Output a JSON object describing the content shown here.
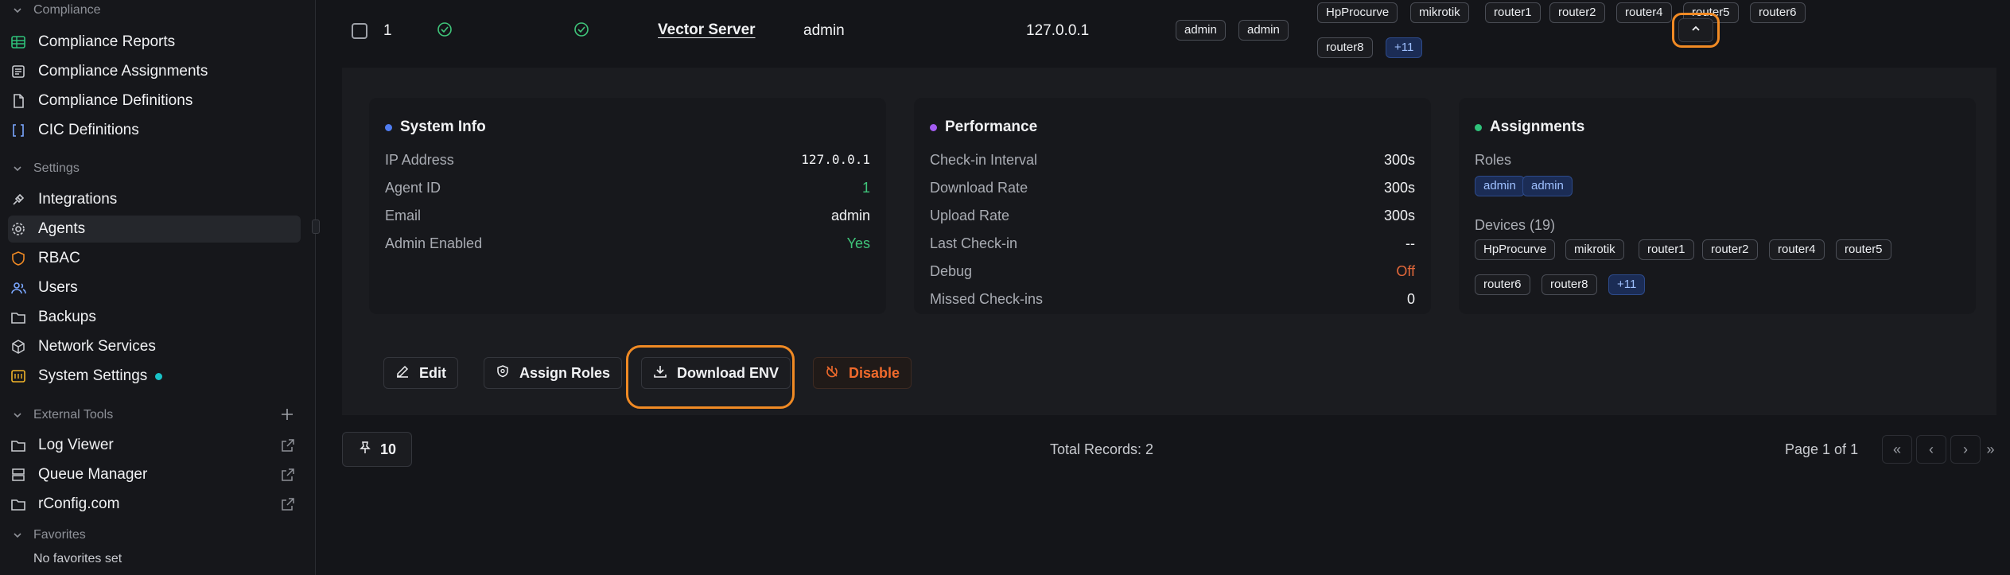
{
  "sidebar": {
    "compliance_header": "Compliance",
    "compliance_items": [
      {
        "label": "Compliance Reports",
        "icon": "table-grid-icon"
      },
      {
        "label": "Compliance Assignments",
        "icon": "assignment-icon"
      },
      {
        "label": "Compliance Definitions",
        "icon": "document-icon"
      },
      {
        "label": "CIC Definitions",
        "icon": "code-bracket-icon"
      }
    ],
    "settings_header": "Settings",
    "settings_items": [
      {
        "label": "Integrations",
        "icon": "plug-icon"
      },
      {
        "label": "Agents",
        "icon": "gear-icon"
      },
      {
        "label": "RBAC",
        "icon": "shield-icon"
      },
      {
        "label": "Users",
        "icon": "users-icon"
      },
      {
        "label": "Backups",
        "icon": "folder-icon"
      },
      {
        "label": "Network Services",
        "icon": "cube-icon"
      },
      {
        "label": "System Settings",
        "icon": "settings-panel-icon"
      }
    ],
    "external_header": "External Tools",
    "external_items": [
      {
        "label": "Log Viewer",
        "icon": "folder-icon"
      },
      {
        "label": "Queue Manager",
        "icon": "layers-icon"
      },
      {
        "label": "rConfig.com",
        "icon": "globe-icon"
      }
    ],
    "favorites_header": "Favorites",
    "favorites_empty": "No favorites set"
  },
  "row": {
    "index": "1",
    "name": "Vector Server",
    "email": "admin",
    "ip": "127.0.0.1",
    "roles": [
      "admin",
      "admin"
    ],
    "devices": [
      "HpProcurve",
      "mikrotik",
      "router1",
      "router2",
      "router4",
      "router5",
      "router6",
      "router8"
    ],
    "devices_more": "+11"
  },
  "system_info": {
    "title": "System Info",
    "dot_color": "#4f7cf0",
    "items": [
      {
        "k": "IP Address",
        "v": "127.0.0.1"
      },
      {
        "k": "Agent ID",
        "v": "1"
      },
      {
        "k": "Email",
        "v": "admin"
      },
      {
        "k": "Admin Enabled",
        "v": "Yes"
      }
    ]
  },
  "performance": {
    "title": "Performance",
    "dot_color": "#a35cf0",
    "items": [
      {
        "k": "Check-in Interval",
        "v": "300s"
      },
      {
        "k": "Download Rate",
        "v": "300s"
      },
      {
        "k": "Upload Rate",
        "v": "300s"
      },
      {
        "k": "Last Check-in",
        "v": "--"
      },
      {
        "k": "Debug",
        "v": "Off"
      },
      {
        "k": "Missed Check-ins",
        "v": "0"
      }
    ]
  },
  "assignments": {
    "title": "Assignments",
    "dot_color": "#2fc27a",
    "roles_label": "Roles",
    "roles": [
      "admin",
      "admin"
    ],
    "devices_label": "Devices (19)",
    "devices": [
      "HpProcurve",
      "mikrotik",
      "router1",
      "router2",
      "router4",
      "router5",
      "router6",
      "router8"
    ],
    "devices_more": "+11"
  },
  "actions": {
    "edit": "Edit",
    "assign_roles": "Assign Roles",
    "download_env": "Download ENV",
    "disable": "Disable"
  },
  "footer": {
    "per_page": "10",
    "total": "Total Records: 2",
    "page_info": "Page 1 of 1",
    "first": "«",
    "prev": "‹",
    "next": "›",
    "last": "»"
  },
  "colors": {
    "highlight": "#f08a24",
    "accent_teal": "#19c2c7",
    "success": "#3fc57a",
    "danger": "#f06a2c"
  }
}
